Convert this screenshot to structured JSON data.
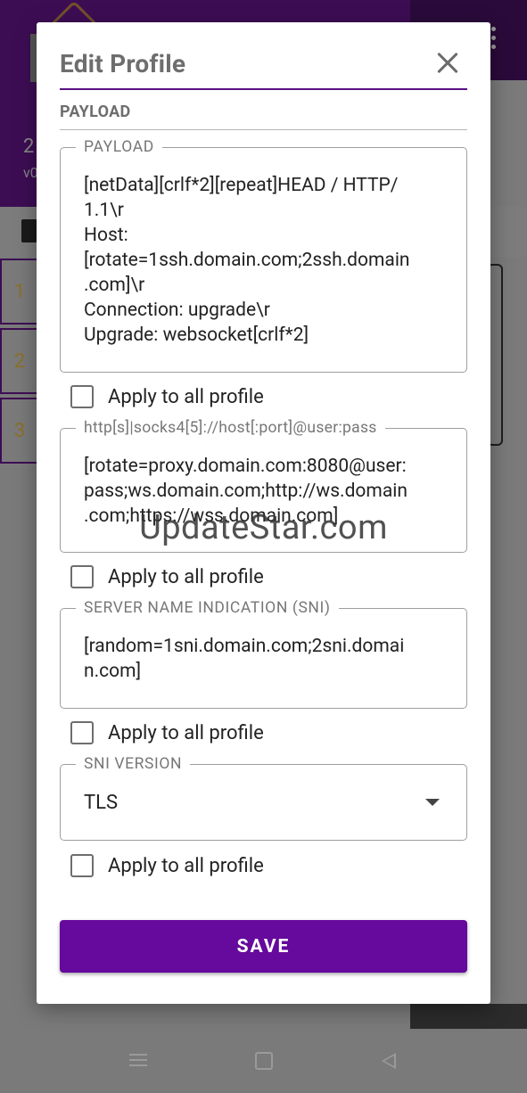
{
  "background": {
    "header_line1": "2",
    "header_line2": "v0",
    "rows": [
      "1",
      "2",
      "3"
    ]
  },
  "dialog": {
    "title": "Edit Profile",
    "section": "PAYLOAD",
    "payload": {
      "label": "PAYLOAD",
      "value": "[netData][crlf*2][repeat]HEAD / HTTP/\n1.1\\r\nHost:\n[rotate=1ssh.domain.com;2ssh.domain\n.com]\\r\nConnection: upgrade\\r\nUpgrade: websocket[crlf*2]"
    },
    "proxy": {
      "label": "http[s]|socks4[5]://host[:port]@user:pass",
      "value": "[rotate=proxy.domain.com:8080@user:\npass;ws.domain.com;http://ws.domain\n.com;https://wss.domain.com]"
    },
    "sni": {
      "label": "SERVER NAME INDICATION (SNI)",
      "value": "[random=1sni.domain.com;2sni.domai\nn.com]"
    },
    "sni_version": {
      "label": "SNI VERSION",
      "selected": "TLS"
    },
    "apply_all_label": "Apply to all profile",
    "save_label": "SAVE"
  },
  "watermark": "UpdateStar.com",
  "colors": {
    "accent": "#650a9c",
    "header_bg": "#3d0d54"
  }
}
